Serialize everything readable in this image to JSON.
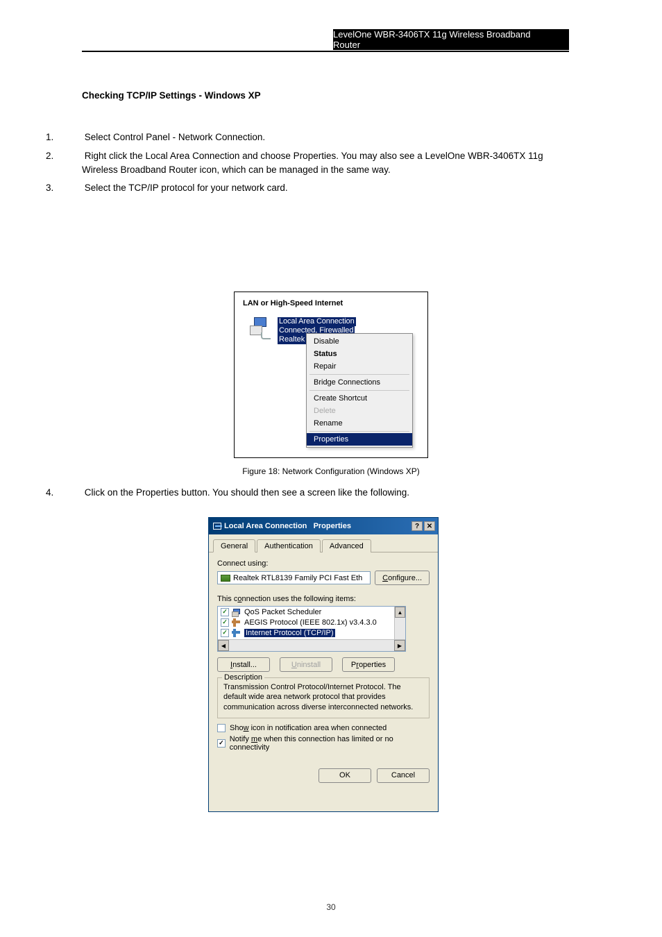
{
  "header": {
    "brand": "LevelOne WBR-3406TX 11g Wireless Broadband Router"
  },
  "section": {
    "title": "Checking TCP/IP Settings - Windows XP",
    "step1_label": "1.",
    "step1_text": " Select Control Panel - Network Connection.",
    "step2_label": "2.",
    "step2_text": " Right click the Local Area Connection and choose Properties. You may also see a LevelOne WBR-3406TX 11g Wireless Broadband Router icon, which can be managed in the same way.",
    "step3_label": "3.",
    "step3_text": " Select the TCP/IP protocol for your network card."
  },
  "fig1": {
    "caption": "Figure 18: Network Configuration (Windows XP)",
    "title": "LAN or High-Speed Internet",
    "conn_name": "Local Area Connection",
    "conn_status": "Connected, Firewalled",
    "conn_nic": "Realtek",
    "menu": {
      "disable": "Disable",
      "status": "Status",
      "repair": "Repair",
      "bridge": "Bridge Connections",
      "shortcut": "Create Shortcut",
      "delete": "Delete",
      "rename": "Rename",
      "properties": "Properties"
    }
  },
  "fig2": {
    "dialog_title_pre": "Local Area Connection",
    "dialog_title_suf": "Properties",
    "tabs": {
      "general": "General",
      "auth": "Authentication",
      "adv": "Advanced"
    },
    "connect_using": "Connect using:",
    "adapter": "Realtek RTL8139 Family PCI Fast Eth",
    "configure": "Configure...",
    "uses_items": "This connection uses the following items:",
    "items": {
      "qos": "QoS Packet Scheduler",
      "aegis": "AEGIS Protocol (IEEE 802.1x) v3.4.3.0",
      "tcpip": "Internet Protocol (TCP/IP)"
    },
    "install": "Install...",
    "uninstall": "Uninstall",
    "properties": "Properties",
    "desc_legend": "Description",
    "desc_text": "Transmission Control Protocol/Internet Protocol. The default wide area network protocol that provides communication across diverse interconnected networks.",
    "show_icon_pre": "Sho",
    "show_icon_u": "w",
    "show_icon_post": " icon in notification area when connected",
    "notify_pre": "Notify ",
    "notify_u": "m",
    "notify_post": "e when this connection has limited or no connectivity",
    "ok": "OK",
    "cancel": "Cancel",
    "install_u": "I",
    "install_post": "nstall...",
    "uninstall_u": "U",
    "uninstall_post": "ninstall",
    "props_u": "r",
    "props_pre": "P",
    "props_post": "operties",
    "connect_u": "o",
    "connect_pre": "This c",
    "connect_post": "nnection uses the following items:",
    "configure_u": "C",
    "configure_post": "onfigure..."
  },
  "after_fig1": " Click on the Properties button. You should then see a screen like the following.",
  "step_after_label": "4.",
  "page_number": "30"
}
